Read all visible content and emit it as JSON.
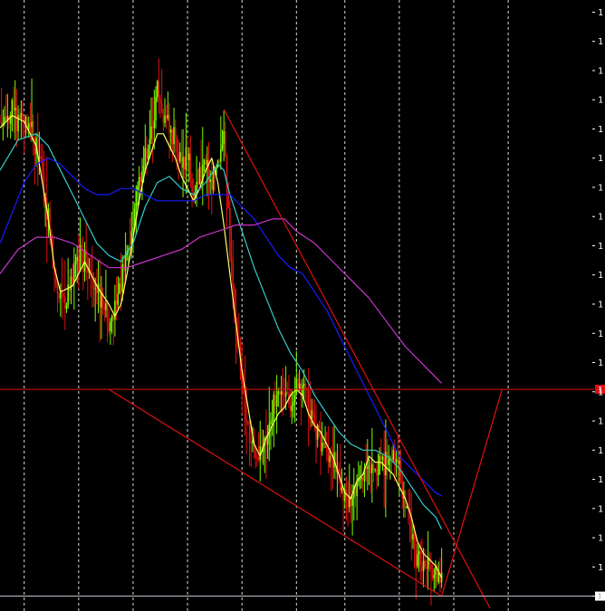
{
  "chart_data": {
    "type": "candlestick",
    "title": "",
    "xlabel": "",
    "ylabel": "",
    "grid": {
      "vertical": true,
      "horizontal": false,
      "style": "dashed"
    },
    "ylim": [
      0,
      100
    ],
    "xlim": [
      0,
      100
    ],
    "y_tick_values": [
      98,
      93.2,
      88.4,
      83.6,
      78.8,
      74,
      69.2,
      64.4,
      59.6,
      54.8,
      50,
      45.2,
      40.4,
      35.6,
      30.8,
      26,
      21.2,
      16.4,
      11.6,
      6.8,
      2
    ],
    "y_tick_labels": [
      "1",
      "1",
      "1",
      "1",
      "1",
      "1",
      "1",
      "1",
      "1",
      "1",
      "1",
      "1",
      "1",
      "1",
      "1",
      "1",
      "1",
      "1",
      "1",
      "1",
      "1"
    ],
    "vertical_grid_x": [
      4,
      13,
      22,
      31,
      40,
      49,
      57,
      66,
      75,
      84
    ],
    "colors": {
      "background": "#000000",
      "candle_up": "#7CFC00",
      "candle_down": "#e01010",
      "grid": "#ffffff",
      "ma_fast": "#ffff66",
      "ma_medium": "#33cccc",
      "ma_slow": "#1a1aff",
      "ma_slowest": "#cc33cc",
      "trendline": "#e01010",
      "level_line": "#e01010",
      "current_price_line": "#c0c0d0",
      "level_marker_bg": "#e01010",
      "current_marker_bg": "#ffffff"
    },
    "series": [
      {
        "role": "ma_fast",
        "points": [
          [
            0,
            79
          ],
          [
            2,
            81
          ],
          [
            4,
            80
          ],
          [
            6,
            76
          ],
          [
            7,
            70
          ],
          [
            8,
            64
          ],
          [
            9,
            56
          ],
          [
            10,
            52
          ],
          [
            12,
            53
          ],
          [
            14,
            57
          ],
          [
            16,
            53
          ],
          [
            18,
            50
          ],
          [
            19,
            48
          ],
          [
            20,
            50
          ],
          [
            21,
            55
          ],
          [
            22,
            61
          ],
          [
            23,
            67
          ],
          [
            24,
            72
          ],
          [
            25,
            75
          ],
          [
            26,
            78
          ],
          [
            27,
            78
          ],
          [
            28,
            76
          ],
          [
            29,
            74
          ],
          [
            30,
            71
          ],
          [
            31,
            69
          ],
          [
            32,
            67
          ],
          [
            33,
            69
          ],
          [
            34,
            72
          ],
          [
            35,
            74
          ],
          [
            36,
            70
          ],
          [
            37,
            63
          ],
          [
            38,
            55
          ],
          [
            39,
            47
          ],
          [
            40,
            39
          ],
          [
            41,
            33
          ],
          [
            42,
            27
          ],
          [
            43,
            25
          ],
          [
            44,
            28
          ],
          [
            45,
            30
          ],
          [
            46,
            32
          ],
          [
            47,
            33
          ],
          [
            48,
            35
          ],
          [
            49,
            36
          ],
          [
            50,
            35
          ],
          [
            51,
            32
          ],
          [
            52,
            30
          ],
          [
            53,
            29
          ],
          [
            54,
            27
          ],
          [
            55,
            25
          ],
          [
            56,
            22
          ],
          [
            57,
            19
          ],
          [
            58,
            18
          ],
          [
            59,
            21
          ],
          [
            60,
            22
          ],
          [
            61,
            25
          ],
          [
            62,
            24
          ],
          [
            63,
            24
          ],
          [
            64,
            23
          ],
          [
            65,
            22
          ],
          [
            66,
            20
          ],
          [
            67,
            18
          ],
          [
            68,
            15
          ],
          [
            69,
            11
          ],
          [
            70,
            9
          ],
          [
            71,
            8
          ],
          [
            72,
            7
          ],
          [
            73,
            5
          ]
        ]
      },
      {
        "role": "ma_medium",
        "points": [
          [
            0,
            72
          ],
          [
            3,
            77
          ],
          [
            6,
            78
          ],
          [
            8,
            76
          ],
          [
            10,
            72
          ],
          [
            12,
            68
          ],
          [
            14,
            64
          ],
          [
            16,
            60
          ],
          [
            18,
            58
          ],
          [
            20,
            57
          ],
          [
            22,
            60
          ],
          [
            24,
            66
          ],
          [
            26,
            70
          ],
          [
            28,
            71
          ],
          [
            30,
            69
          ],
          [
            32,
            68
          ],
          [
            34,
            70
          ],
          [
            36,
            73
          ],
          [
            37,
            72
          ],
          [
            38,
            68
          ],
          [
            40,
            62
          ],
          [
            42,
            56
          ],
          [
            44,
            51
          ],
          [
            46,
            46
          ],
          [
            48,
            42
          ],
          [
            50,
            39
          ],
          [
            52,
            35
          ],
          [
            54,
            32
          ],
          [
            56,
            29
          ],
          [
            58,
            27
          ],
          [
            60,
            26
          ],
          [
            62,
            26
          ],
          [
            64,
            25
          ],
          [
            66,
            23
          ],
          [
            68,
            20
          ],
          [
            70,
            17
          ],
          [
            72,
            15
          ],
          [
            73,
            13
          ]
        ]
      },
      {
        "role": "ma_slow",
        "points": [
          [
            0,
            60
          ],
          [
            2,
            65
          ],
          [
            4,
            70
          ],
          [
            6,
            73
          ],
          [
            8,
            74
          ],
          [
            10,
            73
          ],
          [
            12,
            71
          ],
          [
            14,
            69
          ],
          [
            16,
            68
          ],
          [
            18,
            68
          ],
          [
            20,
            69
          ],
          [
            22,
            69
          ],
          [
            24,
            68
          ],
          [
            26,
            67
          ],
          [
            28,
            67
          ],
          [
            30,
            67
          ],
          [
            32,
            67
          ],
          [
            34,
            68
          ],
          [
            36,
            68
          ],
          [
            38,
            68
          ],
          [
            40,
            66
          ],
          [
            42,
            64
          ],
          [
            44,
            61
          ],
          [
            46,
            58
          ],
          [
            48,
            56
          ],
          [
            50,
            55
          ],
          [
            52,
            52
          ],
          [
            54,
            49
          ],
          [
            56,
            45
          ],
          [
            58,
            41
          ],
          [
            60,
            37
          ],
          [
            62,
            33
          ],
          [
            64,
            29
          ],
          [
            66,
            25
          ],
          [
            68,
            23
          ],
          [
            70,
            21
          ],
          [
            72,
            19
          ],
          [
            73,
            18.5
          ]
        ]
      },
      {
        "role": "ma_slowest",
        "points": [
          [
            0,
            55
          ],
          [
            3,
            59
          ],
          [
            6,
            61
          ],
          [
            9,
            61
          ],
          [
            12,
            60
          ],
          [
            15,
            58
          ],
          [
            18,
            56
          ],
          [
            21,
            56
          ],
          [
            24,
            57
          ],
          [
            27,
            58
          ],
          [
            30,
            59
          ],
          [
            33,
            61
          ],
          [
            36,
            62
          ],
          [
            39,
            63
          ],
          [
            42,
            63
          ],
          [
            45,
            64
          ],
          [
            47,
            64
          ],
          [
            49,
            62
          ],
          [
            52,
            60
          ],
          [
            55,
            57
          ],
          [
            58,
            54
          ],
          [
            61,
            51
          ],
          [
            64,
            47
          ],
          [
            67,
            43
          ],
          [
            70,
            40
          ],
          [
            73,
            37
          ]
        ]
      },
      {
        "role": "trendline_upper",
        "points": [
          [
            37,
            82
          ],
          [
            81,
            0
          ]
        ]
      },
      {
        "role": "trendline_lower",
        "points": [
          [
            18,
            36
          ],
          [
            73,
            2
          ]
        ]
      },
      {
        "role": "projection",
        "points": [
          [
            73,
            2
          ],
          [
            83,
            36
          ]
        ]
      }
    ],
    "candles_seed": 20,
    "candles_path": [
      [
        0,
        80
      ],
      [
        2,
        82
      ],
      [
        3,
        80
      ],
      [
        4,
        80
      ],
      [
        5,
        78
      ],
      [
        6,
        76
      ],
      [
        7,
        71
      ],
      [
        8,
        63
      ],
      [
        9,
        56
      ],
      [
        10,
        52
      ],
      [
        11,
        51
      ],
      [
        12,
        55
      ],
      [
        13,
        58
      ],
      [
        14,
        57
      ],
      [
        15,
        55
      ],
      [
        16,
        52
      ],
      [
        17,
        51
      ],
      [
        18,
        46
      ],
      [
        19,
        50
      ],
      [
        20,
        54
      ],
      [
        21,
        58
      ],
      [
        22,
        64
      ],
      [
        23,
        70
      ],
      [
        24,
        73
      ],
      [
        25,
        77
      ],
      [
        26,
        86
      ],
      [
        27,
        81
      ],
      [
        28,
        79
      ],
      [
        29,
        76
      ],
      [
        30,
        73
      ],
      [
        31,
        75
      ],
      [
        32,
        68
      ],
      [
        33,
        71
      ],
      [
        34,
        74
      ],
      [
        35,
        70
      ],
      [
        36,
        72
      ],
      [
        37,
        78
      ],
      [
        38,
        60
      ],
      [
        39,
        45
      ],
      [
        40,
        36
      ],
      [
        41,
        30
      ],
      [
        42,
        26
      ],
      [
        43,
        25
      ],
      [
        44,
        28
      ],
      [
        45,
        33
      ],
      [
        46,
        35
      ],
      [
        47,
        36
      ],
      [
        48,
        33
      ],
      [
        49,
        36
      ],
      [
        50,
        37
      ],
      [
        51,
        34
      ],
      [
        52,
        31
      ],
      [
        53,
        28
      ],
      [
        54,
        27
      ],
      [
        55,
        24
      ],
      [
        56,
        22
      ],
      [
        57,
        18
      ],
      [
        58,
        16
      ],
      [
        59,
        19
      ],
      [
        60,
        22
      ],
      [
        61,
        24
      ],
      [
        62,
        23
      ],
      [
        63,
        24
      ],
      [
        64,
        23
      ],
      [
        65,
        25
      ],
      [
        66,
        22
      ],
      [
        67,
        17
      ],
      [
        68,
        13
      ],
      [
        69,
        8
      ],
      [
        70,
        9
      ],
      [
        71,
        7
      ],
      [
        72,
        6
      ],
      [
        73,
        5
      ]
    ],
    "horizontal_levels": [
      {
        "role": "level_line",
        "value": 36,
        "label": "1"
      },
      {
        "role": "current_price",
        "value": 2,
        "label": "1"
      }
    ]
  }
}
